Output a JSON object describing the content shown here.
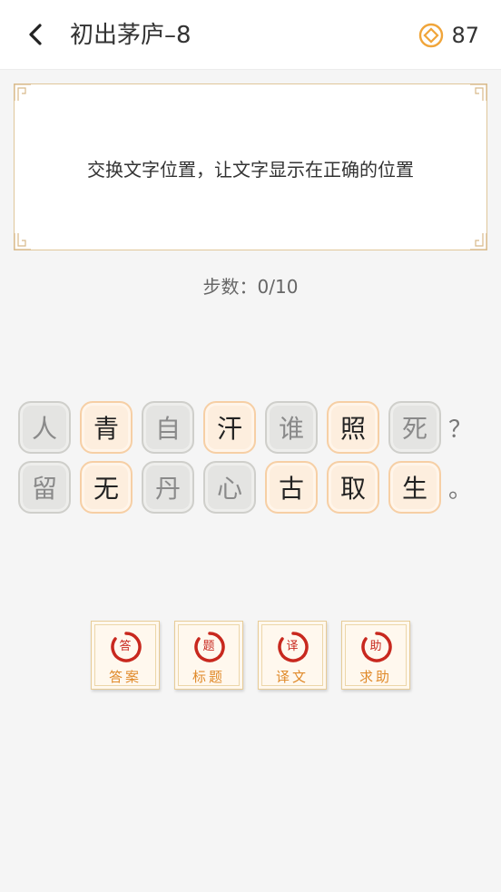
{
  "header": {
    "title": "初出茅庐–8",
    "coins": "87",
    "back_icon": "back-arrow-icon",
    "coin_icon": "coin-icon",
    "accent_color": "#f0a53a"
  },
  "puzzle": {
    "instruction": "交换文字位置，让文字显示在正确的位置",
    "steps": "步数：0/10"
  },
  "grid": {
    "row1": {
      "tiles": [
        "人",
        "青",
        "自",
        "汗",
        "谁",
        "照",
        "死"
      ],
      "styles": [
        "gray",
        "peach",
        "gray",
        "peach",
        "gray",
        "peach",
        "gray"
      ],
      "punct": "？"
    },
    "row2": {
      "tiles": [
        "留",
        "无",
        "丹",
        "心",
        "古",
        "取",
        "生"
      ],
      "styles": [
        "gray",
        "peach",
        "gray",
        "gray",
        "peach",
        "peach",
        "peach"
      ],
      "punct": "。"
    }
  },
  "tools": [
    {
      "seal": "答",
      "label": "答案"
    },
    {
      "seal": "题",
      "label": "标题"
    },
    {
      "seal": "译",
      "label": "译文"
    },
    {
      "seal": "助",
      "label": "求助"
    }
  ]
}
